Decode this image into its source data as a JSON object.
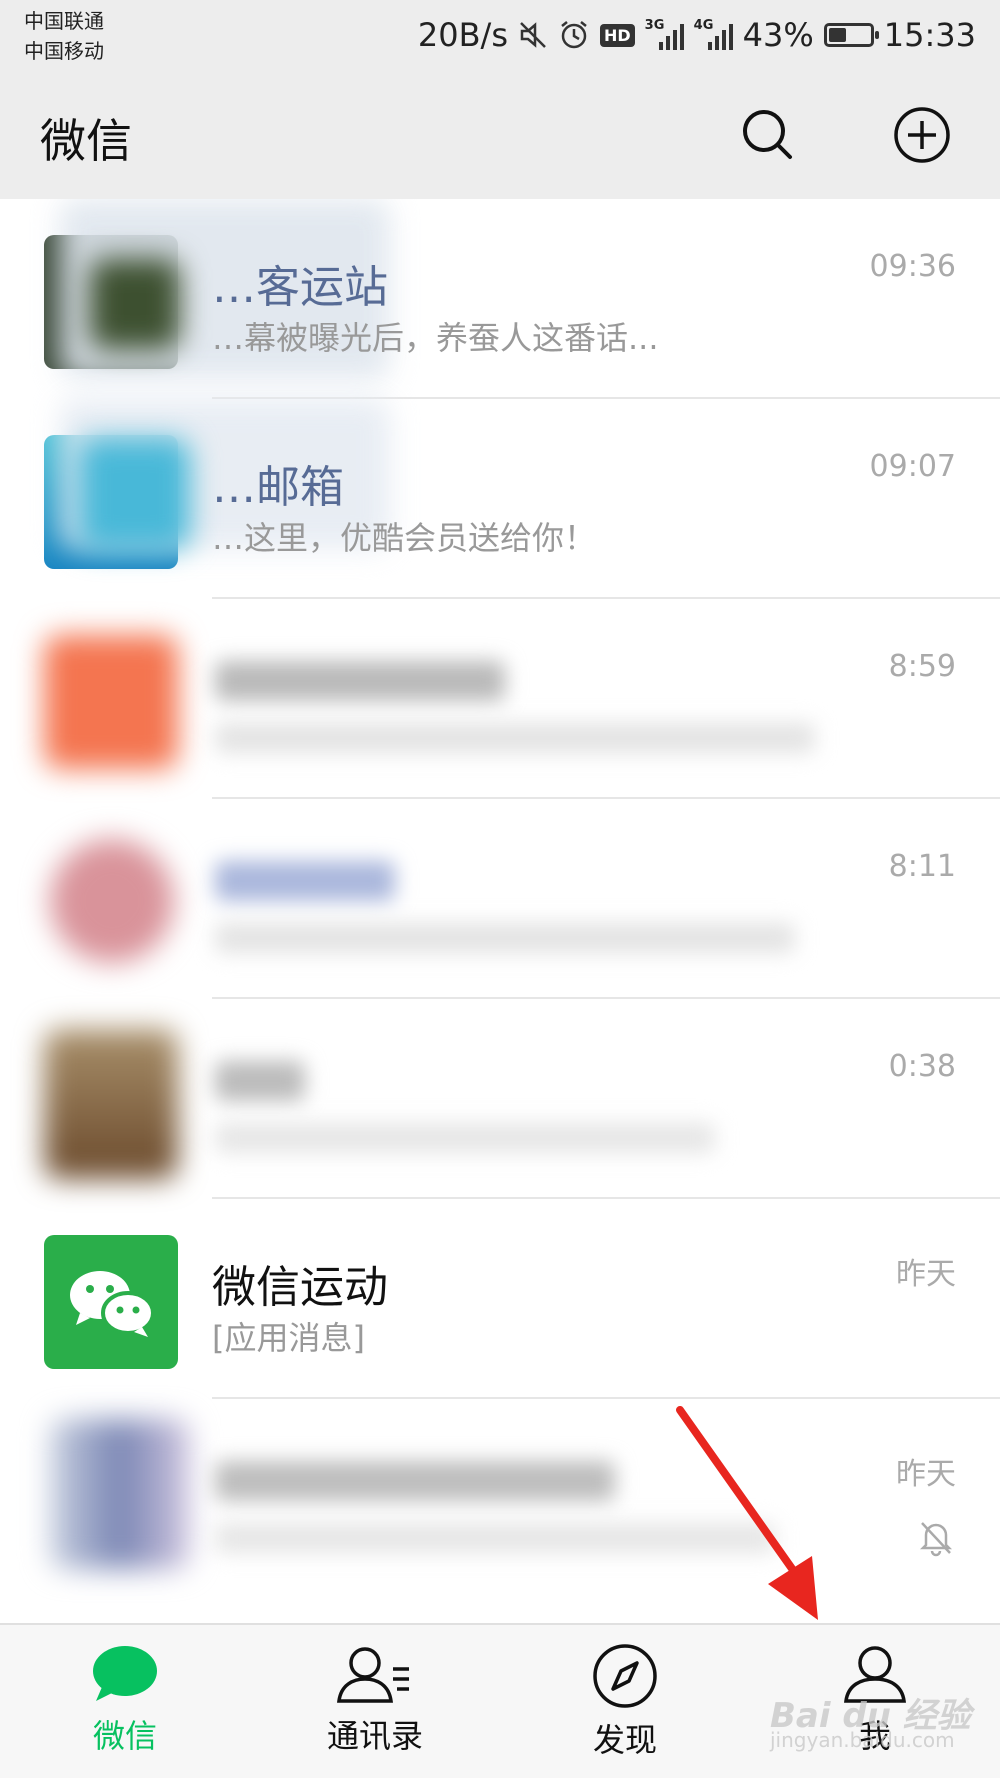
{
  "status_bar": {
    "carrier1": "中国联通",
    "carrier2": "中国移动",
    "speed": "20B/s",
    "hd": "HD",
    "net1": "3G",
    "net2": "4G",
    "battery": "43%",
    "battery_level": 0.43,
    "clock": "15:33"
  },
  "header": {
    "title": "微信",
    "search_icon": "search-icon",
    "add_icon": "plus-circle-icon"
  },
  "chats": [
    {
      "name": "…客运站",
      "preview": "…幕被曝光后，养蚕人这番话...",
      "time": "09:36",
      "link": true
    },
    {
      "name": "…邮箱",
      "preview": "…这里，优酷会员送给你！",
      "time": "09:07",
      "link": true
    },
    {
      "name": "",
      "preview": "",
      "time": "8:59",
      "link": false
    },
    {
      "name": "",
      "preview": "",
      "time": "8:11",
      "link": true
    },
    {
      "name": "",
      "preview": "",
      "time": "0:38",
      "link": false
    },
    {
      "name": "微信运动",
      "preview": "[应用消息]",
      "time": "昨天",
      "link": false
    },
    {
      "name": "",
      "preview": "",
      "time": "昨天",
      "link": false,
      "muted": true
    }
  ],
  "tabs": [
    {
      "label": "微信",
      "icon": "chat-bubble-icon",
      "active": true
    },
    {
      "label": "通讯录",
      "icon": "contacts-icon",
      "active": false
    },
    {
      "label": "发现",
      "icon": "compass-icon",
      "active": false
    },
    {
      "label": "我",
      "icon": "person-icon",
      "active": false
    }
  ],
  "colors": {
    "accent": "#07c160",
    "link_name": "#576b95",
    "annotation_arrow": "#e8261f"
  },
  "watermark": {
    "main": "Bai du 经验",
    "sub": "jingyan.baidu.com"
  }
}
